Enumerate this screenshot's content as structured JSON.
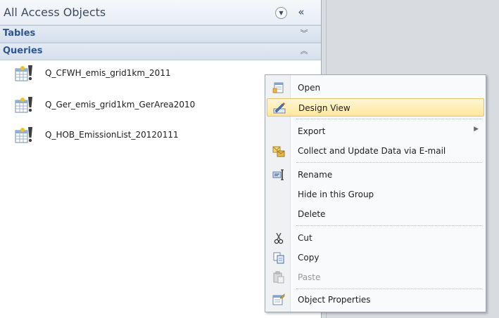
{
  "pane": {
    "title": "All Access Objects",
    "groups": [
      {
        "label": "Tables",
        "state": "collapsed"
      },
      {
        "label": "Queries",
        "state": "expanded"
      }
    ],
    "queries": [
      {
        "label": "Q_CFWH_emis_grid1km_2011"
      },
      {
        "label": "Q_Ger_emis_grid1km_GerArea2010"
      },
      {
        "label": "Q_HOB_EmissionList_20120111"
      }
    ]
  },
  "context_menu": {
    "items": [
      {
        "label": "Open",
        "icon": "open-icon",
        "highlighted": false
      },
      {
        "label": "Design View",
        "icon": "design-view-icon",
        "highlighted": true
      },
      {
        "label": "Export",
        "icon": "",
        "submenu": true
      },
      {
        "label": "Collect and Update Data via E-mail",
        "icon": "collect-data-icon"
      },
      {
        "label": "Rename",
        "icon": "rename-icon"
      },
      {
        "label": "Hide in this Group",
        "icon": ""
      },
      {
        "label": "Delete",
        "icon": ""
      },
      {
        "label": "Cut",
        "icon": "scissors-icon"
      },
      {
        "label": "Copy",
        "icon": "copy-icon"
      },
      {
        "label": "Paste",
        "icon": "paste-icon",
        "disabled": true
      },
      {
        "label": "Object Properties",
        "icon": "properties-icon"
      }
    ]
  },
  "colors": {
    "group_text": "#2d5693",
    "highlight": "#ffe79a",
    "right_area": "#d8dce1"
  }
}
